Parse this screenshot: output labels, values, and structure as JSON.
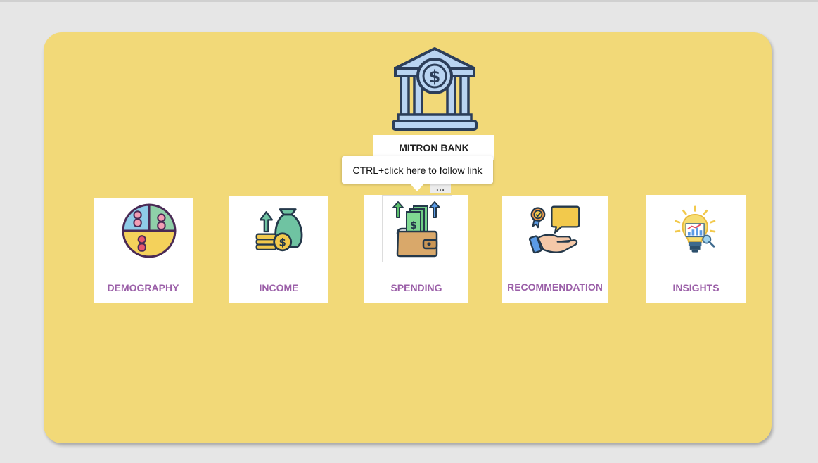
{
  "bank": {
    "name": "MITRON BANK",
    "logo_icon": "bank-icon"
  },
  "tooltip": {
    "text": "CTRL+click here to follow link"
  },
  "more_button": {
    "label": "…"
  },
  "nav_cards": [
    {
      "label": "DEMOGRAPHY",
      "icon": "demography-pie-icon"
    },
    {
      "label": "INCOME",
      "icon": "income-money-bag-icon"
    },
    {
      "label": "SPENDING",
      "icon": "spending-wallet-icon"
    },
    {
      "label": "RECOMMENDATION",
      "icon": "recommendation-hand-icon"
    },
    {
      "label": "INSIGHTS",
      "icon": "insights-bulb-icon"
    }
  ],
  "colors": {
    "page_bg": "#e6e6e6",
    "canvas_bg": "#f2d978",
    "label_purple": "#9b5fa8"
  }
}
